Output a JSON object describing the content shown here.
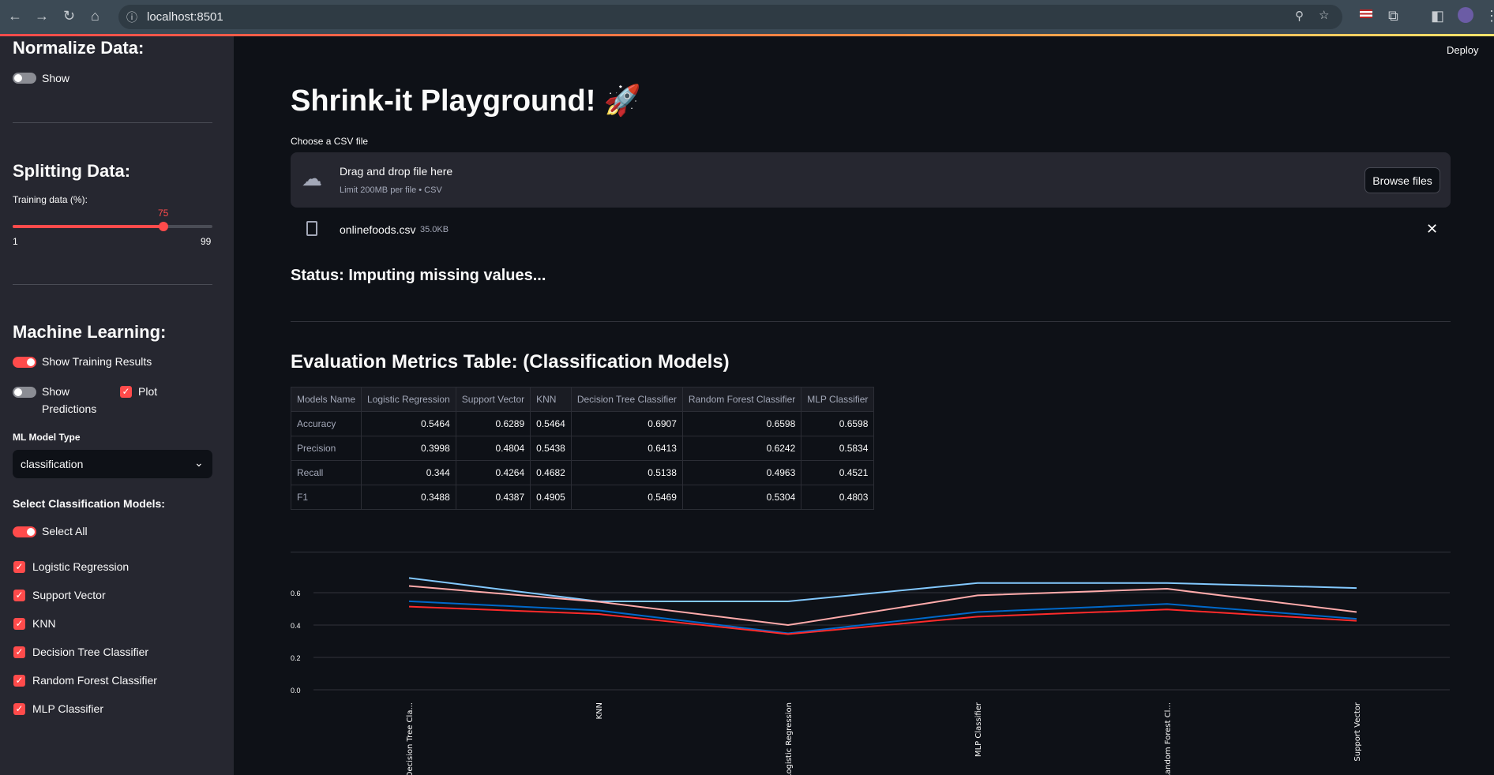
{
  "browser": {
    "url": "localhost:8501"
  },
  "header": {
    "deploy": "Deploy"
  },
  "sidebar": {
    "normalize_title": "Normalize Data:",
    "normalize_toggle": {
      "label": "Show",
      "on": false
    },
    "splitting_title": "Splitting Data:",
    "slider": {
      "label": "Training data (%):",
      "value": "75",
      "min": "1",
      "max": "99"
    },
    "ml_title": "Machine Learning:",
    "show_training": {
      "label": "Show Training Results",
      "on": true
    },
    "show_predictions": {
      "label1": "Show",
      "label2": "Predictions",
      "on": false
    },
    "plot": {
      "label": "Plot",
      "checked": true
    },
    "model_type_label": "ML Model Type",
    "model_type_value": "classification",
    "select_models_title": "Select Classification Models:",
    "select_all": {
      "label": "Select All",
      "on": true
    },
    "models": [
      "Logistic Regression",
      "Support Vector",
      "KNN",
      "Decision Tree Classifier",
      "Random Forest Classifier",
      "MLP Classifier"
    ]
  },
  "main": {
    "title": "Shrink-it Playground! 🚀",
    "uploader_label": "Choose a CSV file",
    "drop_text": "Drag and drop file here",
    "drop_limit": "Limit 200MB per file • CSV",
    "browse": "Browse files",
    "file_name": "onlinefoods.csv",
    "file_size": "35.0KB",
    "status": "Status: Imputing missing values...",
    "table_title": "Evaluation Metrics Table: (Classification Models)",
    "table": {
      "headers": [
        "Models Name",
        "Logistic Regression",
        "Support Vector",
        "KNN",
        "Decision Tree Classifier",
        "Random Forest Classifier",
        "MLP Classifier"
      ],
      "rows": [
        [
          "Accuracy",
          "0.5464",
          "0.6289",
          "0.5464",
          "0.6907",
          "0.6598",
          "0.6598"
        ],
        [
          "Precision",
          "0.3998",
          "0.4804",
          "0.5438",
          "0.6413",
          "0.6242",
          "0.5834"
        ],
        [
          "Recall",
          "0.344",
          "0.4264",
          "0.4682",
          "0.5138",
          "0.4963",
          "0.4521"
        ],
        [
          "F1",
          "0.3488",
          "0.4387",
          "0.4905",
          "0.5469",
          "0.5304",
          "0.4803"
        ]
      ]
    }
  },
  "chart_data": {
    "type": "line",
    "categories": [
      "Decision Tree Cla...",
      "KNN",
      "Logistic Regression",
      "MLP Classifier",
      "Random Forest Cl...",
      "Support Vector"
    ],
    "yticks": [
      "0.0",
      "0.2",
      "0.4",
      "0.6"
    ],
    "ylim": [
      0,
      0.75
    ],
    "grid": true,
    "series": [
      {
        "key": "Accuracy",
        "color": "#83c9ff",
        "values": [
          0.6907,
          0.5464,
          0.5464,
          0.6598,
          0.6598,
          0.6289
        ]
      },
      {
        "key": "Precision",
        "color": "#ffabab",
        "values": [
          0.6413,
          0.5438,
          0.3998,
          0.5834,
          0.6242,
          0.4804
        ]
      },
      {
        "key": "F1",
        "color": "#0068c9",
        "values": [
          0.5469,
          0.4905,
          0.3488,
          0.4803,
          0.5304,
          0.4387
        ]
      },
      {
        "key": "Recall",
        "color": "#ff2b2b",
        "values": [
          0.5138,
          0.4682,
          0.344,
          0.4521,
          0.4963,
          0.4264
        ]
      }
    ]
  }
}
